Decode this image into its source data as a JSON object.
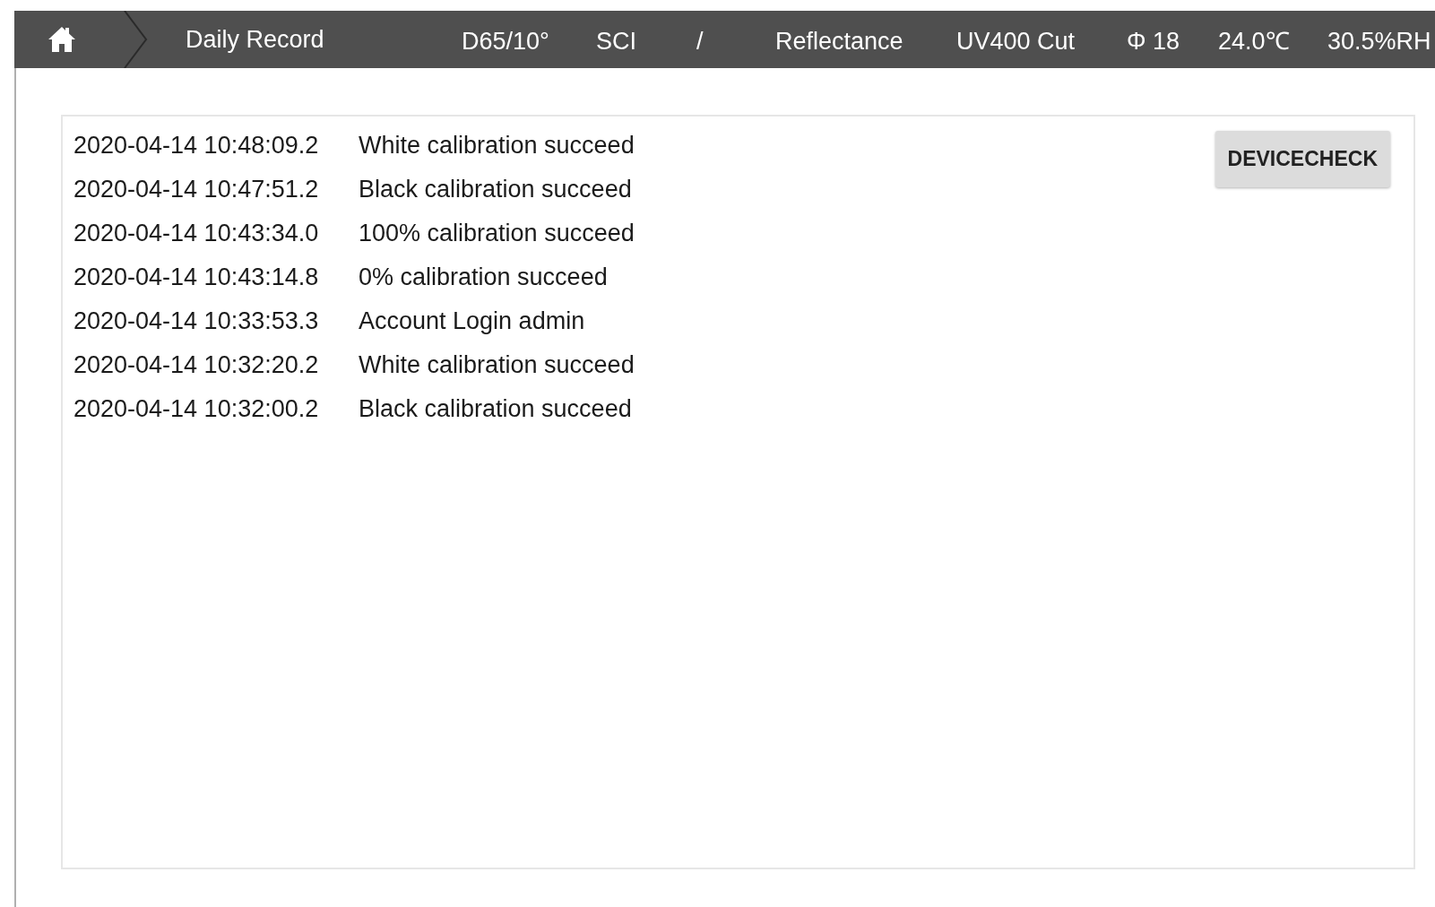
{
  "header": {
    "title": "Daily Record",
    "status": [
      "D65/10°",
      "SCI",
      "/",
      "Reflectance",
      "UV400 Cut",
      "Φ 18",
      "24.0℃",
      "30.5%RH"
    ]
  },
  "log": [
    {
      "time": "2020-04-14 10:48:09.2",
      "message": "White calibration succeed"
    },
    {
      "time": "2020-04-14 10:47:51.2",
      "message": "Black calibration succeed"
    },
    {
      "time": "2020-04-14 10:43:34.0",
      "message": "100% calibration succeed"
    },
    {
      "time": "2020-04-14 10:43:14.8",
      "message": "0% calibration succeed"
    },
    {
      "time": "2020-04-14 10:33:53.3",
      "message": "Account Login admin"
    },
    {
      "time": "2020-04-14 10:32:20.2",
      "message": "White calibration succeed"
    },
    {
      "time": "2020-04-14 10:32:00.2",
      "message": "Black calibration succeed"
    }
  ],
  "button": "DEVICECHECK"
}
